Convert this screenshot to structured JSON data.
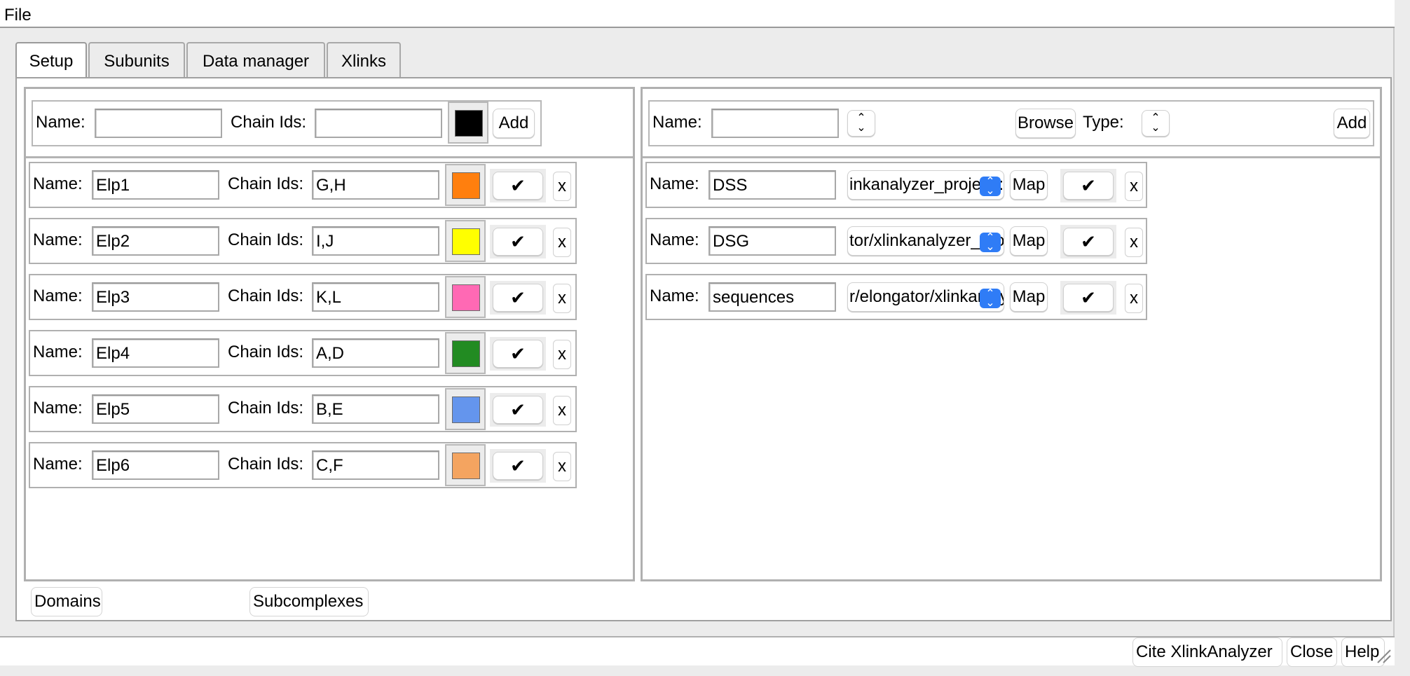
{
  "menubar": {
    "file": "File"
  },
  "tabs": [
    "Setup",
    "Subunits",
    "Data manager",
    "Xlinks"
  ],
  "subunits_panel": {
    "new": {
      "name_label": "Name:",
      "chain_label": "Chain Ids:",
      "name_value": "",
      "chain_value": "",
      "color": "#000000",
      "add_label": "Add"
    },
    "rows": [
      {
        "name_label": "Name:",
        "name": "Elp1",
        "chain_label": "Chain Ids:",
        "chains": "G,H",
        "color": "#ff7f0e",
        "check": "✔",
        "remove": "x"
      },
      {
        "name_label": "Name:",
        "name": "Elp2",
        "chain_label": "Chain Ids:",
        "chains": "I,J",
        "color": "#ffff00",
        "check": "✔",
        "remove": "x"
      },
      {
        "name_label": "Name:",
        "name": "Elp3",
        "chain_label": "Chain Ids:",
        "chains": "K,L",
        "color": "#ff69b4",
        "check": "✔",
        "remove": "x"
      },
      {
        "name_label": "Name:",
        "name": "Elp4",
        "chain_label": "Chain Ids:",
        "chains": "A,D",
        "color": "#228b22",
        "check": "✔",
        "remove": "x"
      },
      {
        "name_label": "Name:",
        "name": "Elp5",
        "chain_label": "Chain Ids:",
        "chains": "B,E",
        "color": "#6495ed",
        "check": "✔",
        "remove": "x"
      },
      {
        "name_label": "Name:",
        "name": "Elp6",
        "chain_label": "Chain Ids:",
        "chains": "C,F",
        "color": "#f4a460",
        "check": "✔",
        "remove": "x"
      }
    ]
  },
  "data_panel": {
    "new": {
      "name_label": "Name:",
      "name_value": "",
      "stepper_icon": "up-down-chevron",
      "browse_label": "Browse",
      "type_label": "Type:",
      "add_label": "Add"
    },
    "rows": [
      {
        "name_label": "Name:",
        "name": "DSS",
        "path": "inkanalyzer_project/:",
        "map_label": "Map",
        "check": "✔",
        "remove": "x"
      },
      {
        "name_label": "Name:",
        "name": "DSG",
        "path": "tor/xlinkanalyzer_pro",
        "map_label": "Map",
        "check": "✔",
        "remove": "x"
      },
      {
        "name_label": "Name:",
        "name": "sequences",
        "path": "r/elongator/xlinkanaly",
        "map_label": "Map",
        "check": "✔",
        "remove": "x"
      }
    ]
  },
  "footer_buttons": {
    "domains": "Domains",
    "subcomplexes": "Subcomplexes"
  },
  "statusbar": {
    "cite": "Cite XlinkAnalyzer",
    "close": "Close",
    "help": "Help"
  }
}
